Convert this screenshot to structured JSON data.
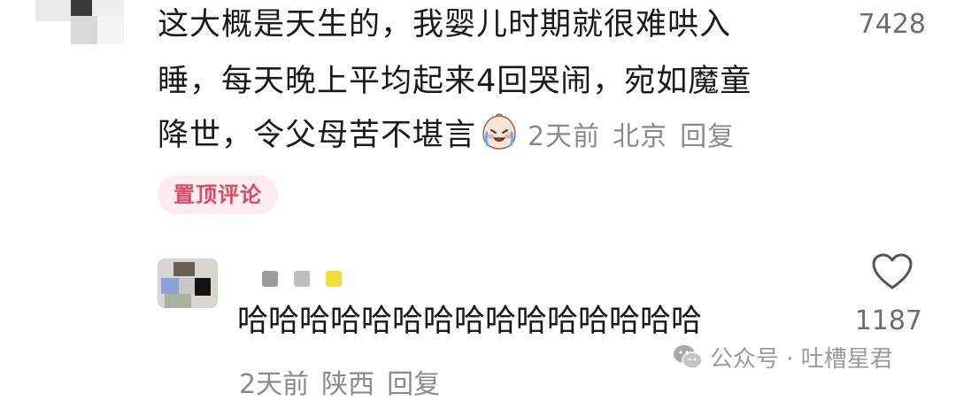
{
  "comment": {
    "lines": [
      "这大概是天生的，我婴儿时期就很难哄入",
      "睡，每天晚上平均起来4回哭闹，宛如魔童",
      "降世，令父母苦不堪言"
    ],
    "emoji": "crying-face-emoji",
    "time": "2天前",
    "location": "北京",
    "reply_label": "回复",
    "like_count": "7428",
    "pin_tag": "置顶评论"
  },
  "reply": {
    "text": "哈哈哈哈哈哈哈哈哈哈哈哈哈哈哈",
    "time": "2天前",
    "location": "陕西",
    "reply_label": "回复",
    "like_count": "1187"
  },
  "watermark": {
    "text": "公众号 · 吐槽星君"
  },
  "colors": {
    "meta_gray": "#8a8a8a",
    "pin_bg": "#fdecef",
    "pin_text": "#d94a64"
  }
}
